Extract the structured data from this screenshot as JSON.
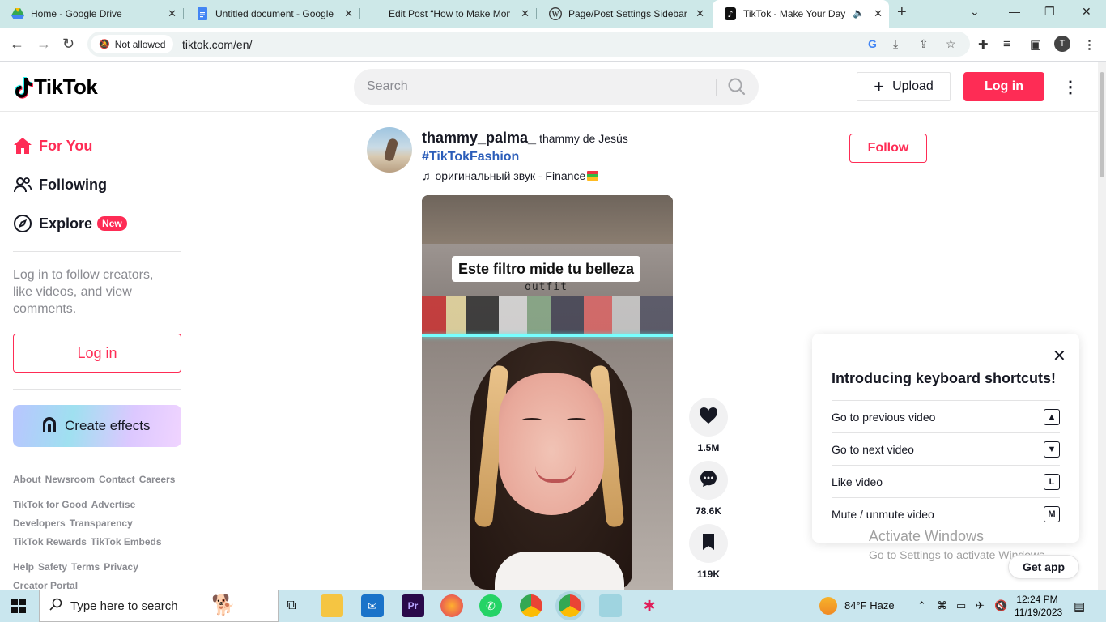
{
  "browser": {
    "tabs": [
      {
        "title": "Home - Google Drive",
        "icon": "google-drive-icon"
      },
      {
        "title": "Untitled document - Google Docs",
        "icon": "google-docs-icon"
      },
      {
        "title": "Edit Post “How to Make Money”",
        "icon": "wordpress-icon"
      },
      {
        "title": "Page/Post Settings Sidebar",
        "icon": "wordpress-icon"
      },
      {
        "title": "TikTok - Make Your Day",
        "icon": "tiktok-icon",
        "active": true
      }
    ],
    "site_chip": "Not allowed",
    "url": "tiktok.com/en/",
    "profile_initial": "T"
  },
  "header": {
    "logo_text": "TikTok",
    "search_placeholder": "Search",
    "upload_label": "Upload",
    "login_label": "Log in"
  },
  "sidebar": {
    "nav": [
      {
        "label": "For You",
        "icon": "home-icon",
        "active": true
      },
      {
        "label": "Following",
        "icon": "following-icon"
      },
      {
        "label": "Explore",
        "icon": "compass-icon",
        "badge": "New"
      }
    ],
    "login_hint": "Log in to follow creators, like videos, and view comments.",
    "login_button": "Log in",
    "effects_label": "Create effects",
    "footer": [
      [
        "About",
        "Newsroom",
        "Contact",
        "Careers"
      ],
      [
        "TikTok for Good",
        "Advertise"
      ],
      [
        "Developers",
        "Transparency"
      ],
      [
        "TikTok Rewards",
        "TikTok Embeds"
      ],
      [
        "Help",
        "Safety",
        "Terms",
        "Privacy"
      ],
      [
        "Creator Portal"
      ]
    ]
  },
  "post": {
    "username": "thammy_palma_",
    "nickname": "thammy de Jesús",
    "hashtag": "#TikTokFashion",
    "music": "оригинальный звук - Finance",
    "follow_label": "Follow",
    "video_caption": "Este filtro mide tu belleza",
    "video_subtext": "outfit",
    "likes": "1.5M",
    "comments": "78.6K",
    "saves": "119K"
  },
  "shortcuts": {
    "title": "Introducing keyboard shortcuts!",
    "items": [
      {
        "label": "Go to previous video",
        "key": "▲"
      },
      {
        "label": "Go to next video",
        "key": "▼"
      },
      {
        "label": "Like video",
        "key": "L"
      },
      {
        "label": "Mute / unmute video",
        "key": "M"
      }
    ]
  },
  "watermark": {
    "line1": "Activate Windows",
    "line2": "Go to Settings to activate Windows."
  },
  "get_app": "Get app",
  "taskbar": {
    "search_placeholder": "Type here to search",
    "weather": "84°F  Haze",
    "time": "12:24 PM",
    "date": "11/19/2023"
  },
  "colors": {
    "brand": "#fe2c55",
    "hashtag": "#2b5db9",
    "tab_strip": "#cde8e8"
  }
}
